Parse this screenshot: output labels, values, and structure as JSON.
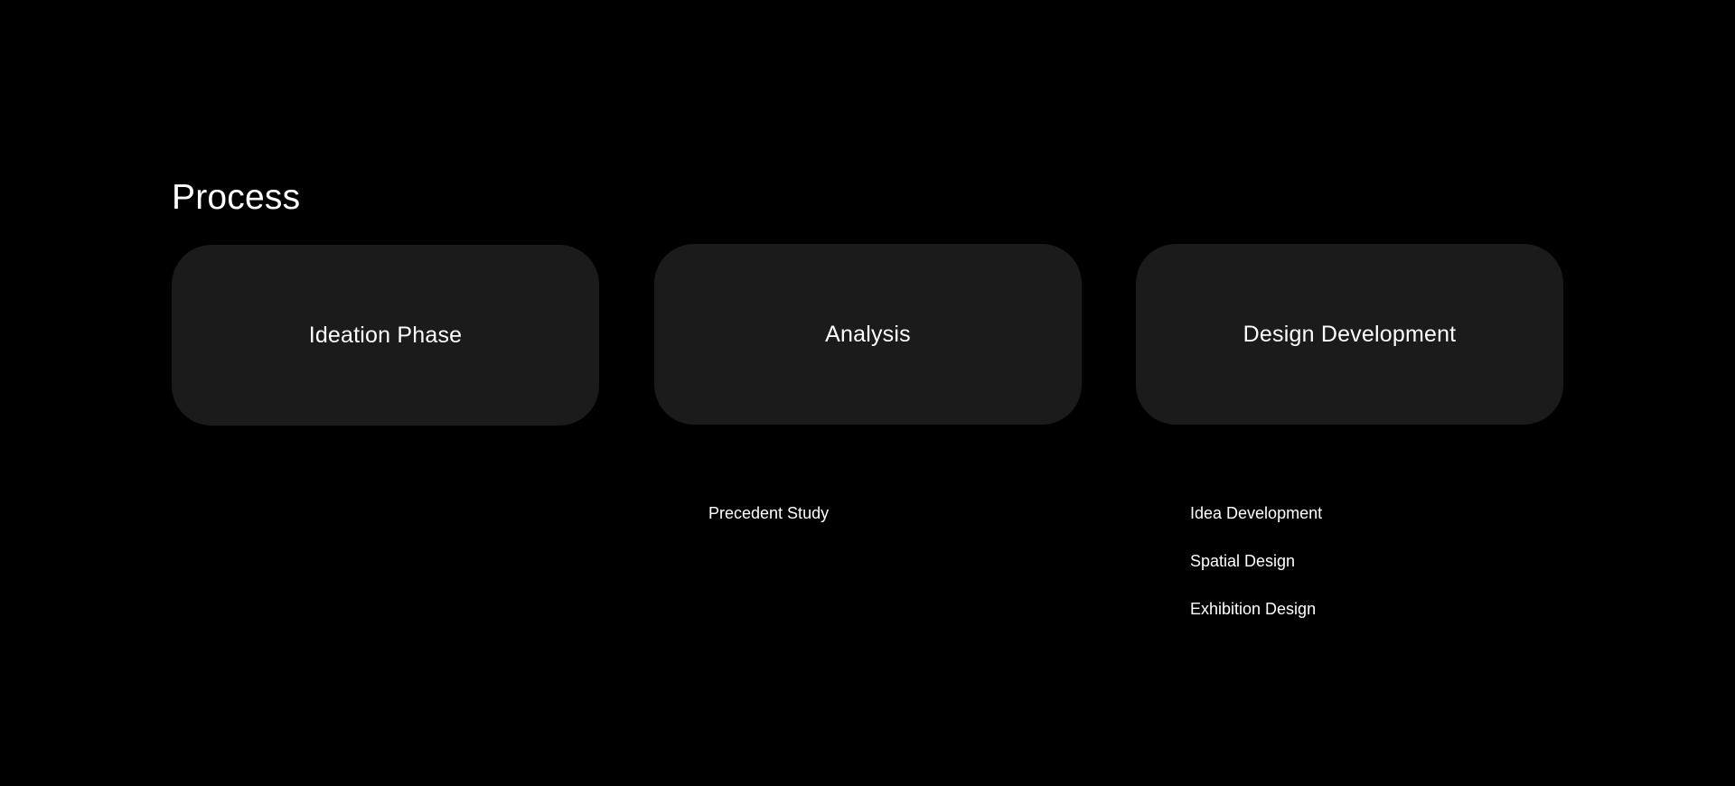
{
  "section": {
    "title": "Process"
  },
  "cards": [
    {
      "label": "Ideation Phase",
      "items": []
    },
    {
      "label": "Analysis",
      "items": [
        "Precedent Study"
      ]
    },
    {
      "label": "Design Development",
      "items": [
        "Idea Development",
        "Spatial Design",
        "Exhibition Design"
      ]
    }
  ],
  "colors": {
    "background": "#000000",
    "card": "#1b1b1b",
    "text": "#ffffff"
  }
}
